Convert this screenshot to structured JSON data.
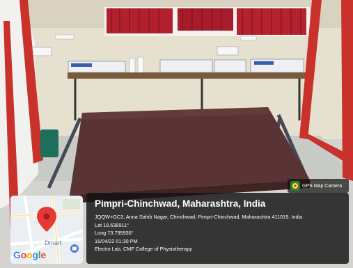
{
  "scene": {
    "description_icons": [
      "treatment-table",
      "electrotherapy-units",
      "window-curtain",
      "red-screen-frame"
    ]
  },
  "gps_badge": {
    "label": "GPS Map Camera",
    "icon": "gps-camera-icon"
  },
  "map_thumbnail": {
    "poi_label": "Dmart",
    "logo_text": [
      "G",
      "o",
      "o",
      "g",
      "l",
      "e"
    ],
    "logo_colors": [
      "#4285F4",
      "#EA4335",
      "#FBBC05",
      "#4285F4",
      "#34A853",
      "#EA4335"
    ],
    "pin_color": "#E53935",
    "icon": "location-pin-icon"
  },
  "info": {
    "title": "Pimpri-Chinchwad, Maharashtra, India",
    "address": "JQQW+GC3, Anna Sahib Nagar, Chinchwad, Pimpri-Chinchwad, Maharashtra 411019, India",
    "lat": "Lat 18.638911°",
    "long": "Long 73.795936°",
    "datetime": "16/04/22 01:30 PM",
    "note": "Electro Lab, CMF College of Physiotherapy"
  },
  "colors": {
    "frame_red": "#c8322a",
    "table_top": "#5a3434",
    "wall": "#e8e2d2",
    "curtain": "#b02030"
  }
}
